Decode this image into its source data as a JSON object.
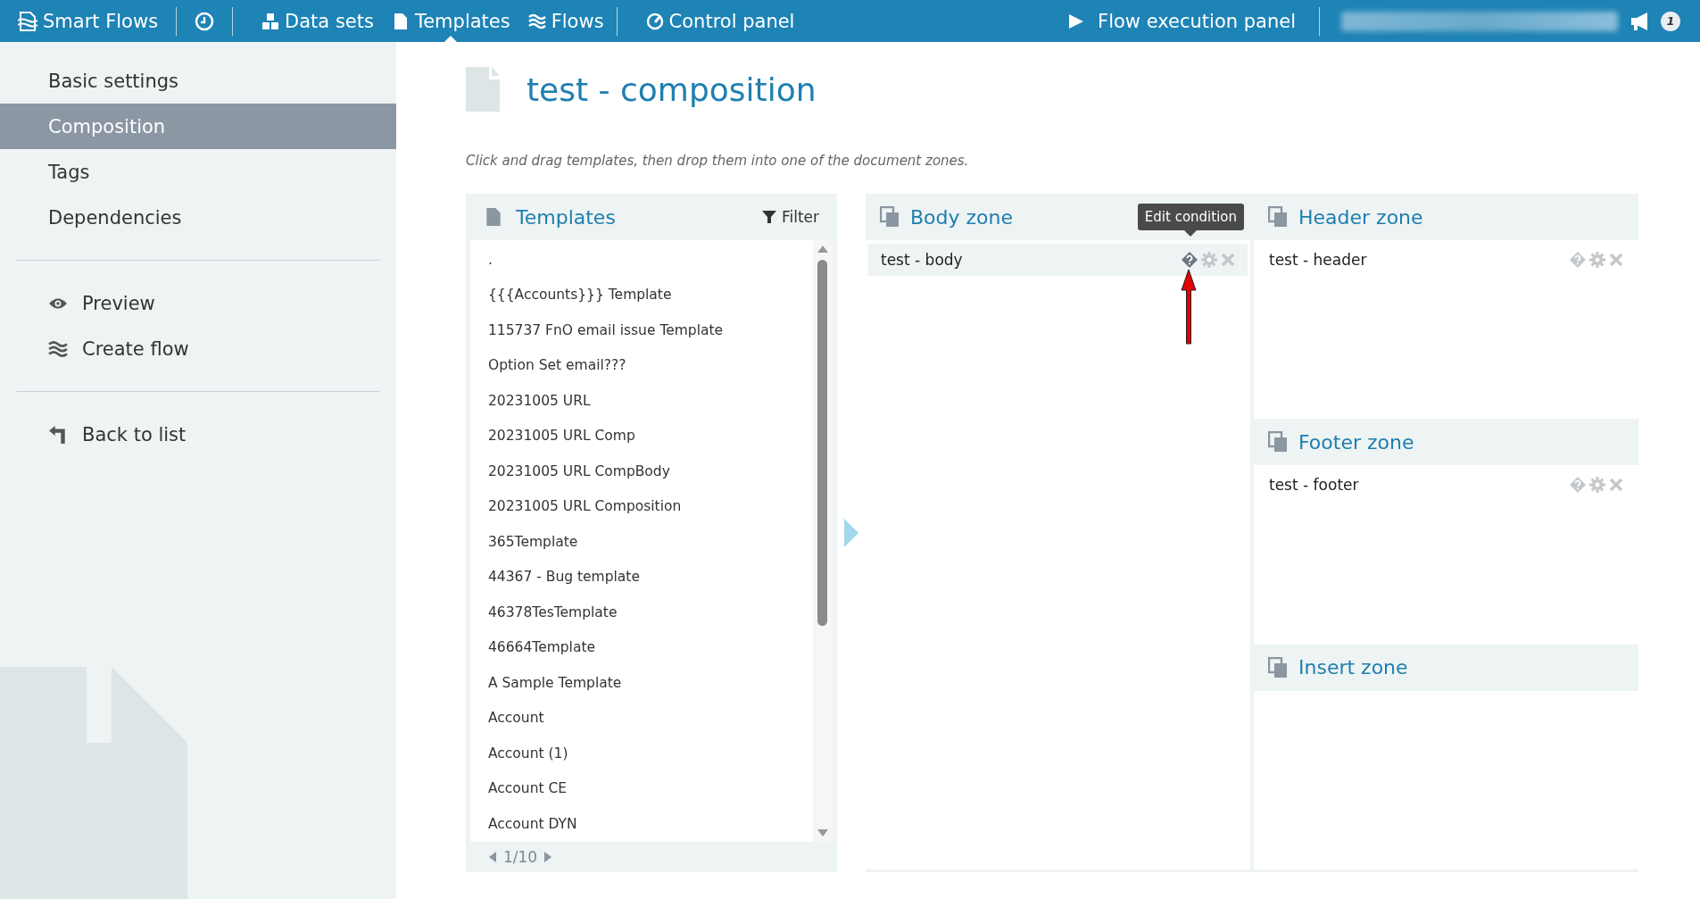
{
  "top_bar": {
    "brand": "Smart Flows",
    "nav": [
      {
        "label": "Data sets",
        "selected": false
      },
      {
        "label": "Templates",
        "selected": true
      },
      {
        "label": "Flows",
        "selected": false
      },
      {
        "label": "Control panel",
        "selected": false
      }
    ],
    "execution": "Flow execution panel",
    "notification_count": "1"
  },
  "sidebar": {
    "groups": [
      [
        {
          "label": "Basic settings",
          "selected": false
        },
        {
          "label": "Composition",
          "selected": true
        },
        {
          "label": "Tags",
          "selected": false
        },
        {
          "label": "Dependencies",
          "selected": false
        }
      ],
      [
        {
          "label": "Preview",
          "selected": false
        },
        {
          "label": "Create flow",
          "selected": false
        }
      ],
      [
        {
          "label": "Back to list",
          "selected": false
        }
      ]
    ]
  },
  "page": {
    "title": "test - composition",
    "hint": "Click and drag templates, then drop them into one of the document zones."
  },
  "templates": {
    "title": "Templates",
    "filter": "Filter",
    "items": [
      ".",
      "{{{Accounts}}} Template",
      "115737 FnO email issue Template",
      "Option Set email???",
      "20231005 URL",
      "20231005 URL Comp",
      "20231005 URL CompBody",
      "20231005 URL Composition",
      "365Template",
      "44367 - Bug template",
      "46378TesTemplate",
      "46664Template",
      "A Sample Template",
      "Account",
      "Account (1)",
      "Account CE",
      "Account DYN"
    ],
    "page": "1/10"
  },
  "zones": [
    {
      "title": "Body zone",
      "items": [
        {
          "name": "test - body",
          "highlighted": true,
          "tooltip": "Edit condition"
        }
      ]
    },
    {
      "title": "Header zone",
      "items": [
        {
          "name": "test - header",
          "highlighted": false
        }
      ]
    },
    {
      "title": "Footer zone",
      "items": [
        {
          "name": "test - footer",
          "highlighted": false
        }
      ]
    },
    {
      "title": "Insert zone"
    }
  ]
}
